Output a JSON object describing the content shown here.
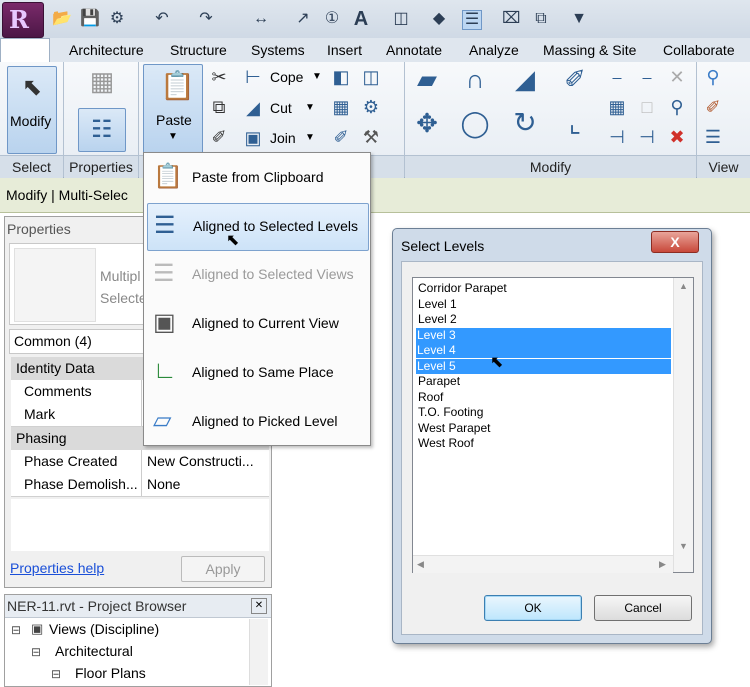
{
  "ribbon_tabs": [
    "Architecture",
    "Structure",
    "Systems",
    "Insert",
    "Annotate",
    "Analyze",
    "Massing & Site",
    "Collaborate"
  ],
  "ribbon": {
    "modify_label": "Modify",
    "paste_label": "Paste",
    "cope_label": "Cope",
    "cut_label": "Cut",
    "join_label": "Join",
    "panels": {
      "select": "Select",
      "properties": "Properties",
      "modify": "Modify",
      "view": "View"
    }
  },
  "context_bar": "Modify | Multi-Selec",
  "paste_menu": [
    {
      "label": "Paste from Clipboard",
      "icon": "clipboard-icon",
      "state": "normal"
    },
    {
      "label": "Aligned to Selected Levels",
      "icon": "levels-icon",
      "state": "highlighted"
    },
    {
      "label": "Aligned to Selected Views",
      "icon": "views-icon",
      "state": "disabled"
    },
    {
      "label": "Aligned to Current View",
      "icon": "current-view-icon",
      "state": "normal"
    },
    {
      "label": "Aligned to Same Place",
      "icon": "same-place-icon",
      "state": "normal"
    },
    {
      "label": "Aligned to Picked Level",
      "icon": "picked-level-icon",
      "state": "normal"
    }
  ],
  "properties": {
    "title": "Properties",
    "type_line1": "Multipl",
    "type_line2": "Selecte",
    "filter": "Common (4)",
    "groups": {
      "identity": "Identity Data",
      "phasing": "Phasing"
    },
    "rows": {
      "comments": {
        "key": "Comments",
        "value": ""
      },
      "mark": {
        "key": "Mark",
        "value": ""
      },
      "phase_created": {
        "key": "Phase Created",
        "value": "New Constructi..."
      },
      "phase_demolished": {
        "key": "Phase Demolish...",
        "value": "None"
      }
    },
    "help_link": "Properties help",
    "apply_label": "Apply"
  },
  "project_browser": {
    "title": "NER-11.rvt - Project Browser",
    "items": [
      "Views (Discipline)",
      "Architectural",
      "Floor Plans"
    ]
  },
  "dialog": {
    "title": "Select Levels",
    "close_label": "X",
    "levels": [
      {
        "name": "Corridor Parapet",
        "selected": false
      },
      {
        "name": "Level 1",
        "selected": false
      },
      {
        "name": "Level 2",
        "selected": false
      },
      {
        "name": "Level 3",
        "selected": true
      },
      {
        "name": "Level 4",
        "selected": true
      },
      {
        "name": "Level 5",
        "selected": true
      },
      {
        "name": "Parapet",
        "selected": false
      },
      {
        "name": "Roof",
        "selected": false
      },
      {
        "name": "T.O. Footing",
        "selected": false
      },
      {
        "name": "West Parapet",
        "selected": false
      },
      {
        "name": "West Roof",
        "selected": false
      }
    ],
    "ok_label": "OK",
    "cancel_label": "Cancel"
  },
  "colors": {
    "selection": "#3399ff",
    "menu_highlight": "#cde3f8",
    "context_bar": "#e7ecd8"
  }
}
